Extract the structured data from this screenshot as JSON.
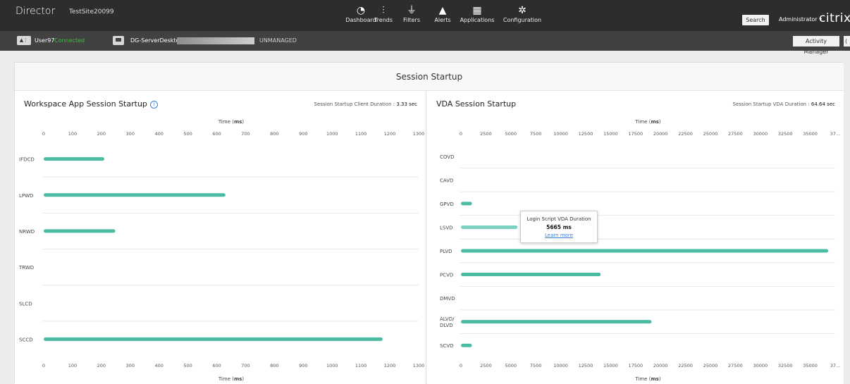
{
  "header": {
    "brand": "Director",
    "site": "TestSite20099",
    "nav": [
      {
        "id": "dashboard",
        "label": "Dashboard",
        "icon": "dashboard-icon"
      },
      {
        "id": "trends",
        "label": "Trends",
        "icon": "trends-icon"
      },
      {
        "id": "filters",
        "label": "Filters",
        "icon": "filters-icon"
      },
      {
        "id": "alerts",
        "label": "Alerts",
        "icon": "alerts-icon"
      },
      {
        "id": "applications",
        "label": "Applications",
        "icon": "applications-icon"
      },
      {
        "id": "configuration",
        "label": "Configuration",
        "icon": "configuration-icon"
      }
    ],
    "search_label": "Search",
    "admin_label": "Administrator",
    "logo": "citrix"
  },
  "subbar": {
    "user": "User97",
    "status": "Connected",
    "machine": "DG-ServerDesktop",
    "managed": "UNMANAGED",
    "activity_manager": "Activity Manager"
  },
  "section_title": "Session Startup",
  "left_panel": {
    "title": "Workspace App Session Startup",
    "duration_label": "Session Startup Client Duration :",
    "duration_value": "3.33 sec"
  },
  "right_panel": {
    "title": "VDA Session Startup",
    "duration_label": "Session Startup VDA Duration :",
    "duration_value": "64.64 sec"
  },
  "tooltip": {
    "title": "Login Script VDA Duration",
    "value": "5665 ms",
    "link": "Learn more"
  },
  "colors": {
    "bar": "#4cbba3",
    "bar_hover": "#7dd3c1",
    "accent": "#3a7fd5",
    "connected": "#3fbf3f"
  },
  "chart_data": [
    {
      "type": "bar",
      "orientation": "horizontal",
      "title": "Workspace App Session Startup",
      "xlabel_prefix": "Time (",
      "xlabel_unit": "ms",
      "xlabel_suffix": ")",
      "xlim": [
        0,
        1300
      ],
      "xticks": [
        "0",
        "100",
        "200",
        "300",
        "400",
        "500",
        "600",
        "700",
        "800",
        "900",
        "1000",
        "1100",
        "1200",
        "1300"
      ],
      "categories": [
        "IFDCD",
        "LPWD",
        "NRWD",
        "TRWD",
        "SLCD",
        "SCCD"
      ],
      "values": [
        210,
        630,
        248,
        0,
        0,
        1175
      ]
    },
    {
      "type": "bar",
      "orientation": "horizontal",
      "title": "VDA Session Startup",
      "xlabel_prefix": "Time (",
      "xlabel_unit": "ms",
      "xlabel_suffix": ")",
      "xlim": [
        0,
        37500
      ],
      "xticks": [
        "0",
        "2500",
        "5000",
        "7500",
        "10000",
        "12500",
        "15000",
        "17500",
        "20000",
        "22500",
        "25000",
        "27500",
        "30000",
        "32500",
        "35000",
        "37..."
      ],
      "categories": [
        "COVD",
        "CAVD",
        "GPVD",
        "LSVD",
        "PLVD",
        "PCVD",
        "DMVD",
        "ALVD/\nDLVD",
        "SCVD"
      ],
      "values": [
        0,
        0,
        1100,
        5665,
        36800,
        14000,
        0,
        19100,
        1100
      ]
    }
  ]
}
